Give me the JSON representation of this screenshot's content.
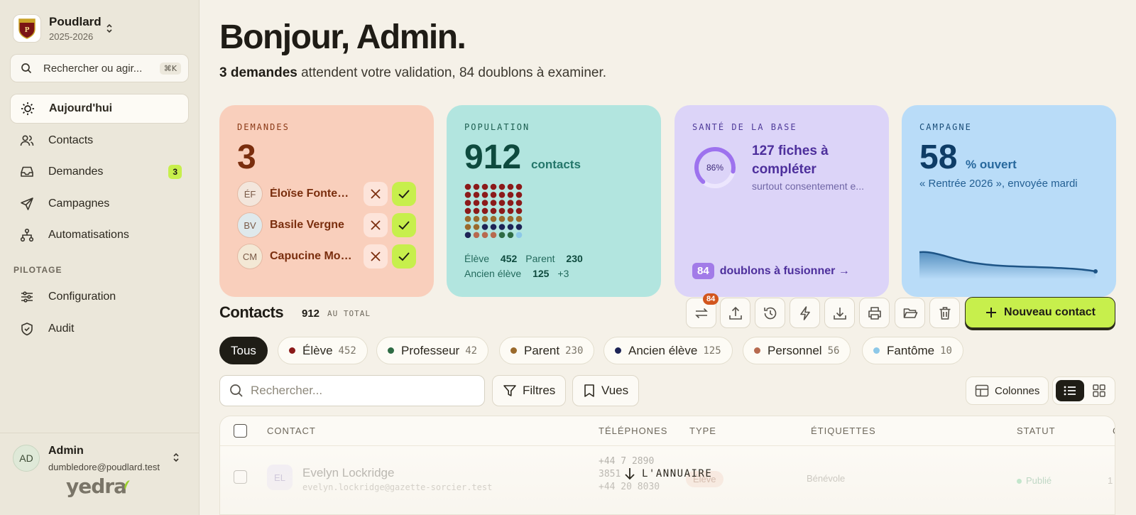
{
  "sidebar": {
    "school_name": "Poudlard",
    "school_year": "2025-2026",
    "search_placeholder": "Rechercher ou agir...",
    "search_shortcut": "⌘K",
    "nav": [
      {
        "label": "Aujourd'hui",
        "icon": "sun-icon",
        "active": true
      },
      {
        "label": "Contacts",
        "icon": "users-icon"
      },
      {
        "label": "Demandes",
        "icon": "inbox-icon",
        "badge": "3"
      },
      {
        "label": "Campagnes",
        "icon": "send-icon"
      },
      {
        "label": "Automatisations",
        "icon": "workflow-icon"
      }
    ],
    "section_label": "PILOTAGE",
    "nav2": [
      {
        "label": "Configuration",
        "icon": "sliders-icon"
      },
      {
        "label": "Audit",
        "icon": "shield-icon"
      }
    ],
    "user": {
      "initials": "AD",
      "name": "Admin",
      "email": "dumbledore@poudlard.test"
    },
    "brand": "yedra"
  },
  "header": {
    "greeting": "Bonjour, Admin.",
    "sub_bold": "3 demandes",
    "sub_rest": " attendent votre validation, 84 doublons à examiner."
  },
  "cards": {
    "demandes": {
      "label": "DEMANDES",
      "count": "3",
      "requests": [
        {
          "initials": "ÉF",
          "name": "Éloïse Fontenelle",
          "color": "#f3e6dc"
        },
        {
          "initials": "BV",
          "name": "Basile Vergne",
          "color": "#dfe9ec"
        },
        {
          "initials": "CM",
          "name": "Capucine Morel",
          "color": "#f3e8d5"
        }
      ]
    },
    "population": {
      "label": "POPULATION",
      "count": "912",
      "unit": "contacts",
      "stats": [
        {
          "label": "Élève",
          "value": "452"
        },
        {
          "label": "Parent",
          "value": "230"
        },
        {
          "label": "Ancien élève",
          "value": "125"
        },
        {
          "label": "",
          "value": "+3"
        }
      ]
    },
    "sante": {
      "label": "SANTÉ DE LA BASE",
      "gauge_value": 86,
      "gauge_text": "86%",
      "title": "127 fiches à compléter",
      "subtitle": "surtout consentement e...",
      "foot_badge": "84",
      "foot_link": "doublons à fusionner →"
    },
    "campagne": {
      "label": "CAMPAGNE",
      "count": "58",
      "unit": "% ouvert",
      "subtitle": "« Rentrée 2026 », envoyée mardi"
    }
  },
  "contacts": {
    "title": "Contacts",
    "count": "912",
    "total_label": "AU TOTAL",
    "toolbar_badge": "84",
    "toolbar_icons": [
      "merge-icon",
      "upload-icon",
      "history-icon",
      "bolt-icon",
      "download-icon",
      "print-icon",
      "folder-icon",
      "trash-icon"
    ],
    "new_button": "Nouveau contact",
    "filters": [
      {
        "label": "Tous",
        "active": true
      },
      {
        "label": "Élève",
        "count": "452",
        "color": "#8b1a1a"
      },
      {
        "label": "Professeur",
        "count": "42",
        "color": "#2e6b44"
      },
      {
        "label": "Parent",
        "count": "230",
        "color": "#9a6a2c"
      },
      {
        "label": "Ancien élève",
        "count": "125",
        "color": "#1d2456"
      },
      {
        "label": "Personnel",
        "count": "56",
        "color": "#b76a4f"
      },
      {
        "label": "Fantôme",
        "count": "10",
        "color": "#8dc8e8"
      }
    ],
    "search_placeholder": "Rechercher...",
    "filters_button": "Filtres",
    "views_button": "Vues",
    "columns_button": "Colonnes",
    "table": {
      "headers": [
        "CONTACT",
        "TÉLÉPHONES",
        "TYPE",
        "ÉTIQUETTES",
        "STATUT",
        "C"
      ],
      "rows": [
        {
          "initials": "EL",
          "name": "Evelyn Lockridge",
          "email": "evelyn.lockridge@gazette-sorcier.test",
          "phone1": "+44 7 2890",
          "phone2": "3851",
          "phone3": "+44 20 8030",
          "type": "Élève",
          "tag": "Bénévole",
          "status": "Publié",
          "extra": "1"
        }
      ]
    },
    "annuaire_label": "L'ANNUAIRE"
  },
  "colors": {
    "accent": "#c7ef4c",
    "demandes_bg": "#f9cfbc",
    "population_bg": "#b2e5df",
    "sante_bg": "#dcd4f8",
    "campagne_bg": "#b9dcf8"
  }
}
